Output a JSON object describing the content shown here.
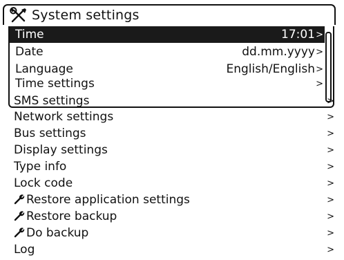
{
  "title": {
    "text": "System settings",
    "icon": "tools-icon"
  },
  "submenu": {
    "items": [
      {
        "label": "Time",
        "value": "17:01",
        "chevron": ">",
        "selected": true
      },
      {
        "label": "Date",
        "value": "dd.mm.yyyy",
        "chevron": ">",
        "selected": false
      },
      {
        "label": "Language",
        "value": "English/English",
        "chevron": ">",
        "selected": false
      },
      {
        "label": "Time settings",
        "value": "",
        "chevron": ">",
        "selected": false
      }
    ]
  },
  "menu": {
    "items": [
      {
        "label": "SMS settings",
        "chevron": ">",
        "icon": ""
      },
      {
        "label": "Network settings",
        "chevron": ">",
        "icon": ""
      },
      {
        "label": "Bus settings",
        "chevron": ">",
        "icon": ""
      },
      {
        "label": "Display settings",
        "chevron": ">",
        "icon": ""
      },
      {
        "label": "Type info",
        "chevron": ">",
        "icon": ""
      },
      {
        "label": "Lock code",
        "chevron": ">",
        "icon": ""
      },
      {
        "label": "Restore application settings",
        "chevron": ">",
        "icon": "wrench-icon"
      },
      {
        "label": "Restore backup",
        "chevron": ">",
        "icon": "wrench-icon"
      },
      {
        "label": "Do backup",
        "chevron": ">",
        "icon": "wrench-icon"
      },
      {
        "label": "Log",
        "chevron": ">",
        "icon": ""
      }
    ]
  },
  "colors": {
    "selected_bg": "#1a1a1a",
    "selected_fg": "#ffffff",
    "foreground": "#111111",
    "background": "#ffffff"
  }
}
